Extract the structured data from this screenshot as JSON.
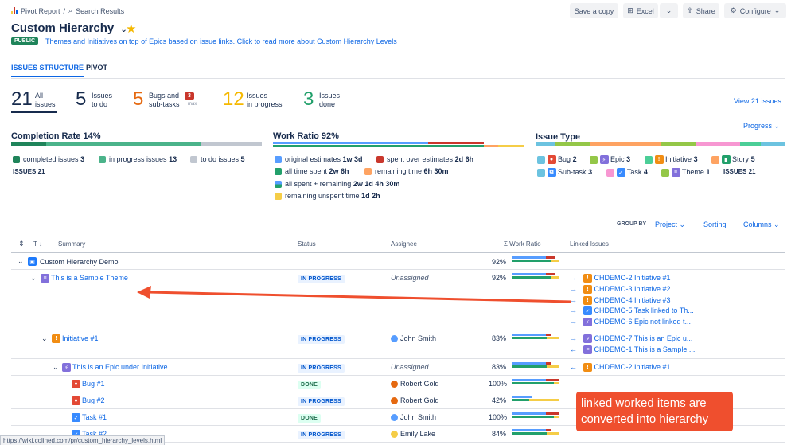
{
  "breadcrumb": {
    "first": "Pivot Report",
    "sep": "/",
    "second": "Search Results"
  },
  "title": "Custom Hierarchy",
  "badge": "PUBLIC",
  "description": "Themes and Initiatives on top of Epics based on issue links. Click to read more about Custom Hierarchy Levels",
  "toolbar": {
    "save_copy": "Save a copy",
    "excel": "Excel",
    "share": "Share",
    "configure": "Configure"
  },
  "tabs": [
    "ISSUES STRUCTURE",
    "PIVOT"
  ],
  "stats": [
    {
      "num": "21",
      "l1": "All",
      "l2": "issues"
    },
    {
      "num": "5",
      "l1": "Issues",
      "l2": "to do"
    },
    {
      "num": "5",
      "l1": "Bugs and",
      "l2": "sub-tasks",
      "badge": "3",
      "badge_sub": "max"
    },
    {
      "num": "12",
      "l1": "Issues",
      "l2": "in progress"
    },
    {
      "num": "3",
      "l1": "Issues",
      "l2": "done"
    }
  ],
  "view_issues": "View 21 issues",
  "progress_dd": "Progress",
  "completion": {
    "label": "Completion Rate",
    "pct": "14%",
    "completed": "completed issues",
    "completed_n": "3",
    "inprog": "in progress issues",
    "inprog_n": "13",
    "todo": "to do issues",
    "todo_n": "5",
    "issues": "ISSUES",
    "issues_n": "21"
  },
  "work": {
    "label": "Work Ratio",
    "pct": "92%",
    "items": [
      {
        "t": "original estimates",
        "v": "1w 3d",
        "c": "#579dff"
      },
      {
        "t": "spent over estimates",
        "v": "2d 6h",
        "c": "#c9372c"
      },
      {
        "t": "all time spent",
        "v": "2w 6h",
        "c": "#22a06b"
      },
      {
        "t": "remaining time",
        "v": "6h 30m",
        "c": "#fea362"
      },
      {
        "t": "all spent + remaining",
        "v": "2w 1d 4h 30m",
        "c": "#579dff"
      },
      {
        "t": "remaining unspent time",
        "v": "1d 2h",
        "c": "#f5cd47"
      }
    ]
  },
  "issuetype": {
    "label": "Issue Type",
    "items": [
      {
        "t": "Bug",
        "n": "2",
        "c": "#f87168",
        "i": "B"
      },
      {
        "t": "Epic",
        "n": "3",
        "c": "#9f8fef",
        "i": "E"
      },
      {
        "t": "Initiative",
        "n": "3",
        "c": "#fea362",
        "i": "I"
      },
      {
        "t": "Story",
        "n": "5",
        "c": "#4bce97",
        "i": "S"
      },
      {
        "t": "Sub-task",
        "n": "3",
        "c": "#579dff",
        "i": "s"
      },
      {
        "t": "Task",
        "n": "4",
        "c": "#388bff",
        "i": "T"
      },
      {
        "t": "Theme",
        "n": "1",
        "c": "#8270db",
        "i": "≡"
      }
    ],
    "issues": "ISSUES",
    "issues_n": "21"
  },
  "controls": {
    "group_by": "GROUP BY",
    "project": "Project",
    "sorting": "Sorting",
    "columns": "Columns"
  },
  "table": {
    "headers": {
      "t": "T",
      "summary": "Summary",
      "status": "Status",
      "assignee": "Assignee",
      "work": "Σ Work Ratio",
      "linked": "Linked Issues"
    },
    "rows": [
      {
        "summary": "Custom Hierarchy Demo",
        "status": "",
        "assignee": "",
        "pct": "92%"
      },
      {
        "summary": "This is a Sample Theme",
        "status": "IN PROGRESS",
        "assignee": "Unassigned",
        "pct": "92%"
      },
      {
        "summary": "Initiative #1",
        "status": "IN PROGRESS",
        "assignee": "John Smith",
        "pct": "83%"
      },
      {
        "summary": "This is an Epic under Initiative",
        "status": "IN PROGRESS",
        "assignee": "Unassigned",
        "pct": "83%"
      },
      {
        "summary": "Bug #1",
        "status": "DONE",
        "assignee": "Robert Gold",
        "pct": "100%"
      },
      {
        "summary": "Bug #2",
        "status": "IN PROGRESS",
        "assignee": "Robert Gold",
        "pct": "42%"
      },
      {
        "summary": "Task #1",
        "status": "DONE",
        "assignee": "John Smith",
        "pct": "100%"
      },
      {
        "summary": "Task #2",
        "status": "IN PROGRESS",
        "assignee": "Emily Lake",
        "pct": "84%"
      }
    ],
    "linked_theme": [
      "CHDEMO-2 Initiative #1",
      "CHDEMO-3 Initiative #2",
      "CHDEMO-4 Initiative #3",
      "CHDEMO-5 Task linked to Th...",
      "CHDEMO-6 Epic not linked t..."
    ],
    "linked_init": [
      "CHDEMO-7 This is an Epic u...",
      "CHDEMO-1 This is a Sample ..."
    ],
    "linked_epic": [
      "CHDEMO-2 Initiative #1"
    ]
  },
  "callout": {
    "line1": "linked worked items are",
    "line2": "converted into hierarchy"
  },
  "status_url": "https://wiki.colined.com/pr/custom_hierarchy_levels.html",
  "colors": {
    "accent": "#0c66e4",
    "callout": "#ef4f2e",
    "green": "#22a06b"
  }
}
